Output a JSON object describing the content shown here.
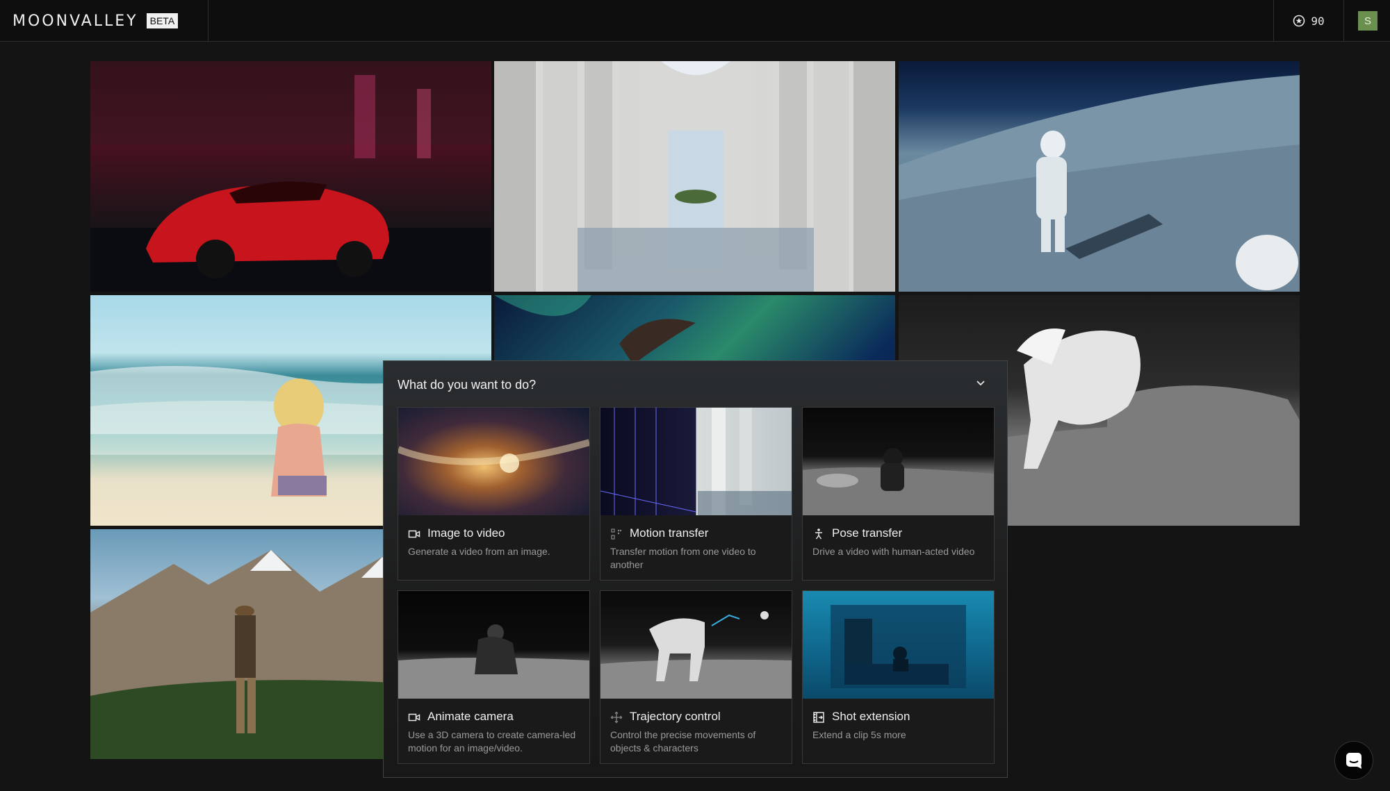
{
  "header": {
    "logo": "MOONVALLEY",
    "badge": "BETA",
    "credits": "90",
    "avatar_initial": "S"
  },
  "dialog": {
    "title": "What do you want to do?",
    "options": [
      {
        "label": "Image to video",
        "description": "Generate a video from an image.",
        "icon": "video-camera-icon"
      },
      {
        "label": "Motion transfer",
        "description": "Transfer motion from one video to another",
        "icon": "motion-dots-icon"
      },
      {
        "label": "Pose transfer",
        "description": "Drive a video with human-acted video",
        "icon": "pose-figure-icon"
      },
      {
        "label": "Animate camera",
        "description": "Use a 3D camera to create camera-led motion for an image/video.",
        "icon": "video-camera-icon"
      },
      {
        "label": "Trajectory control",
        "description": "Control the precise movements of objects & characters",
        "icon": "move-arrows-icon"
      },
      {
        "label": "Shot extension",
        "description": "Extend a clip 5s more",
        "icon": "film-extend-icon"
      }
    ]
  },
  "colors": {
    "background": "#141414",
    "accent_avatar": "#6b8f4e"
  }
}
